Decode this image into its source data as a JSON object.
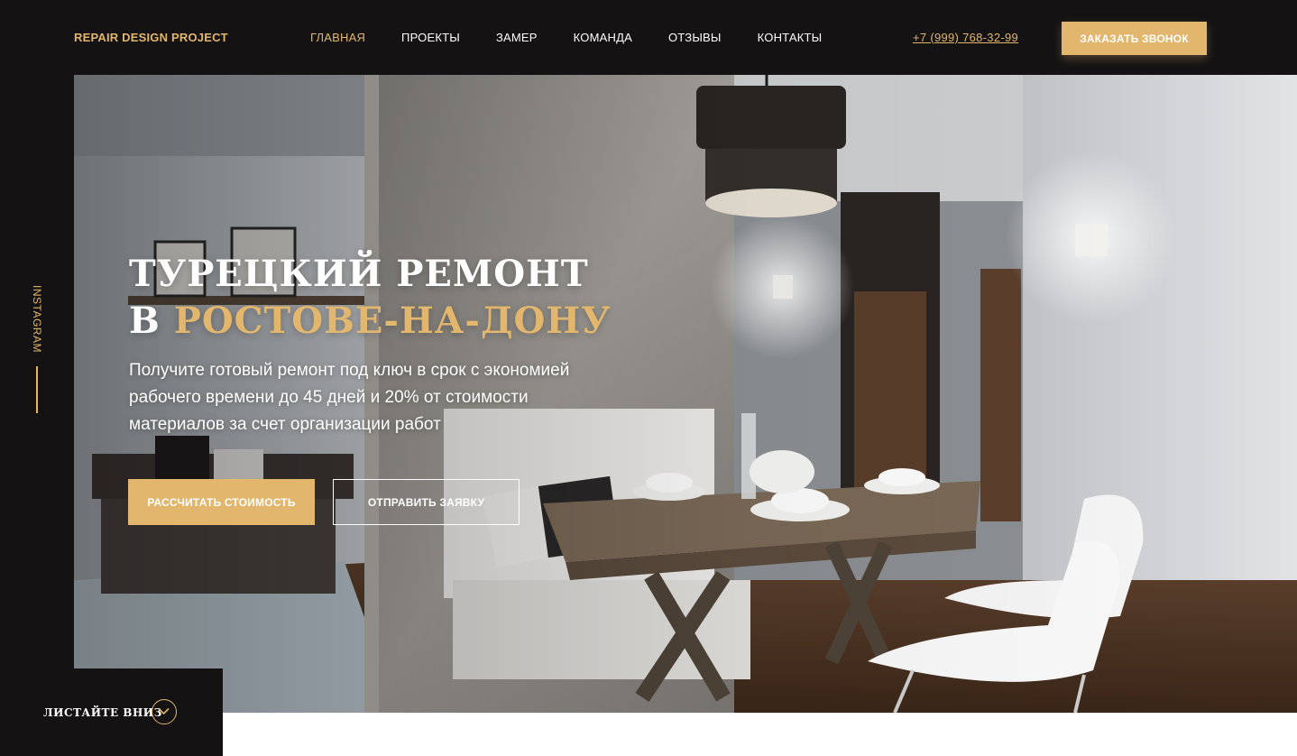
{
  "header": {
    "logo": "REPAIR DESIGN PROJECT",
    "nav": [
      {
        "label": "ГЛАВНАЯ",
        "active": true
      },
      {
        "label": "ПРОЕКТЫ",
        "active": false
      },
      {
        "label": "ЗАМЕР",
        "active": false
      },
      {
        "label": "КОМАНДА",
        "active": false
      },
      {
        "label": "ОТЗЫВЫ",
        "active": false
      },
      {
        "label": "КОНТАКТЫ",
        "active": false
      }
    ],
    "phone": "+7 (999) 768-32-99",
    "callback_button": "ЗАКАЗАТЬ ЗВОНОК"
  },
  "side": {
    "instagram": "INSTAGRAM"
  },
  "hero": {
    "title_line1": "ТУРЕЦКИЙ РЕМОНТ",
    "title_line2_prefix": "В ",
    "title_line2_accent": "РОСТОВЕ-НА-ДОНУ",
    "subtitle": "Получите готовый ремонт под ключ в срок с экономией рабочего времени до 45 дней и 20% от стоимости материалов за счет организации работ",
    "button_calc": "РАССЧИТАТЬ СТОИМОСТЬ",
    "button_send": "ОТПРАВИТЬ ЗАЯВКУ"
  },
  "scroll": {
    "label": "ЛИСТАЙТЕ ВНИЗ"
  },
  "colors": {
    "accent": "#e2b66c",
    "dark": "#141213",
    "white": "#ffffff"
  },
  "icons": [
    "chevron-down-icon"
  ]
}
